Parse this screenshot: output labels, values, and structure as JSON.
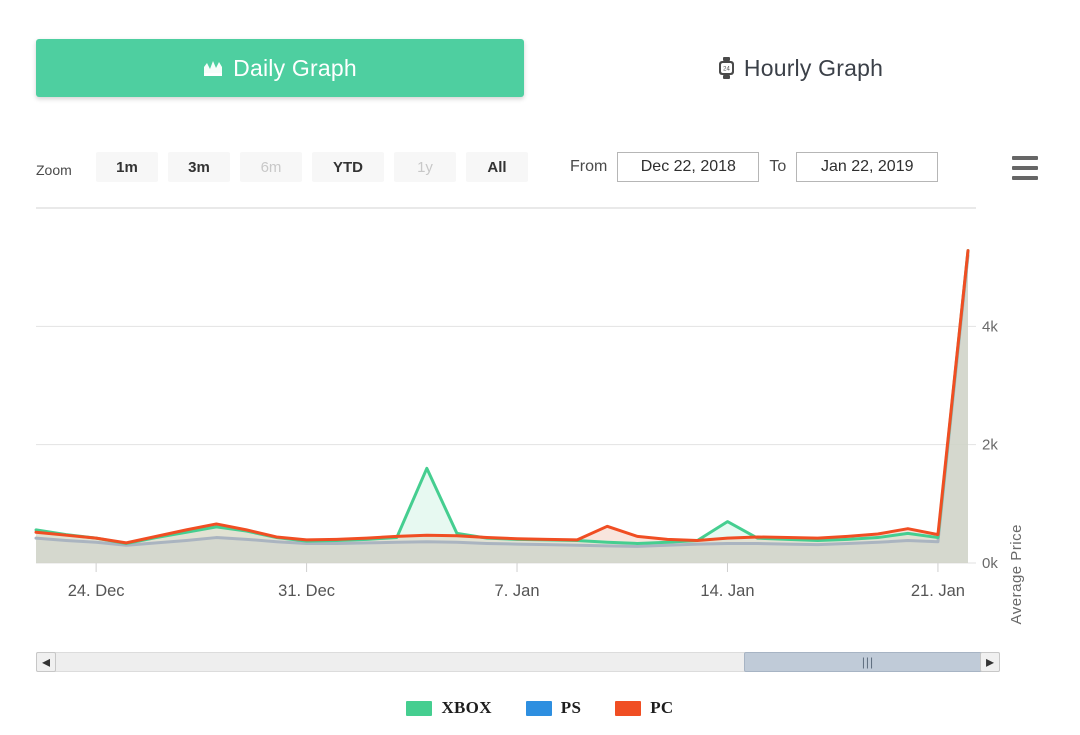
{
  "tabs": [
    {
      "id": "daily",
      "label": "Daily Graph",
      "icon": "bar-chart-icon",
      "active": true
    },
    {
      "id": "hourly",
      "label": "Hourly Graph",
      "icon": "smartwatch-icon",
      "active": false
    }
  ],
  "range_selector": {
    "zoom_label": "Zoom",
    "buttons": [
      {
        "label": "1m",
        "disabled": false
      },
      {
        "label": "3m",
        "disabled": false
      },
      {
        "label": "6m",
        "disabled": true
      },
      {
        "label": "YTD",
        "disabled": false
      },
      {
        "label": "1y",
        "disabled": true
      },
      {
        "label": "All",
        "disabled": false
      }
    ],
    "from_label": "From",
    "from_value": "Dec 22, 2018",
    "to_label": "To",
    "to_value": "Jan 22, 2019",
    "menu_icon": "hamburger-menu-icon"
  },
  "navigator": {
    "left_arrow": "◂",
    "right_arrow": "▸",
    "grip": "|||"
  },
  "legend": [
    {
      "name": "XBOX",
      "color": "#45ce90"
    },
    {
      "name": "PS",
      "color": "#2e8fe0"
    },
    {
      "name": "PC",
      "color": "#f04e23"
    }
  ],
  "colors": {
    "accent_green": "#4ecfa0",
    "xbox": "#45ce90",
    "ps": "#2e8fe0",
    "pc": "#f04e23",
    "pc_fill": "#f7e0d7",
    "gridline": "#e2e2e2",
    "axis_text": "#6a6a6a"
  },
  "chart_data": {
    "type": "line",
    "title": "",
    "xlabel": "",
    "ylabel": "Average Price",
    "ylim": [
      0,
      6000
    ],
    "yticks": [
      0,
      2000,
      4000
    ],
    "ytick_labels": [
      "0k",
      "2k",
      "4k"
    ],
    "grid": true,
    "legend_position": "bottom-center",
    "x_tick_labels": [
      "24. Dec",
      "31. Dec",
      "7. Jan",
      "14. Jan",
      "21. Jan"
    ],
    "x_tick_indices": [
      2,
      9,
      16,
      23,
      30
    ],
    "x": [
      "Dec 22",
      "Dec 23",
      "Dec 24",
      "Dec 25",
      "Dec 26",
      "Dec 27",
      "Dec 28",
      "Dec 29",
      "Dec 30",
      "Dec 31",
      "Jan 1",
      "Jan 2",
      "Jan 3",
      "Jan 4",
      "Jan 5",
      "Jan 6",
      "Jan 7",
      "Jan 8",
      "Jan 9",
      "Jan 10",
      "Jan 11",
      "Jan 12",
      "Jan 13",
      "Jan 14",
      "Jan 15",
      "Jan 16",
      "Jan 17",
      "Jan 18",
      "Jan 19",
      "Jan 20",
      "Jan 21",
      "Jan 22"
    ],
    "series": [
      {
        "name": "XBOX",
        "color": "#45ce90",
        "values": [
          560,
          480,
          420,
          330,
          430,
          520,
          610,
          540,
          430,
          370,
          380,
          400,
          430,
          1600,
          500,
          420,
          400,
          390,
          380,
          350,
          330,
          350,
          380,
          700,
          420,
          400,
          380,
          400,
          430,
          500,
          430,
          5280
        ]
      },
      {
        "name": "PS",
        "color": "#2e8fe0",
        "values": [
          420,
          380,
          350,
          300,
          340,
          380,
          430,
          400,
          360,
          330,
          330,
          340,
          350,
          360,
          350,
          330,
          320,
          310,
          300,
          290,
          280,
          300,
          320,
          330,
          330,
          320,
          310,
          330,
          350,
          380,
          360,
          5200
        ]
      },
      {
        "name": "PC",
        "color": "#f04e23",
        "values": [
          520,
          470,
          420,
          340,
          450,
          560,
          660,
          560,
          440,
          390,
          400,
          420,
          450,
          470,
          460,
          430,
          410,
          400,
          390,
          620,
          450,
          400,
          380,
          420,
          440,
          430,
          420,
          450,
          490,
          580,
          480,
          5280
        ]
      }
    ]
  }
}
